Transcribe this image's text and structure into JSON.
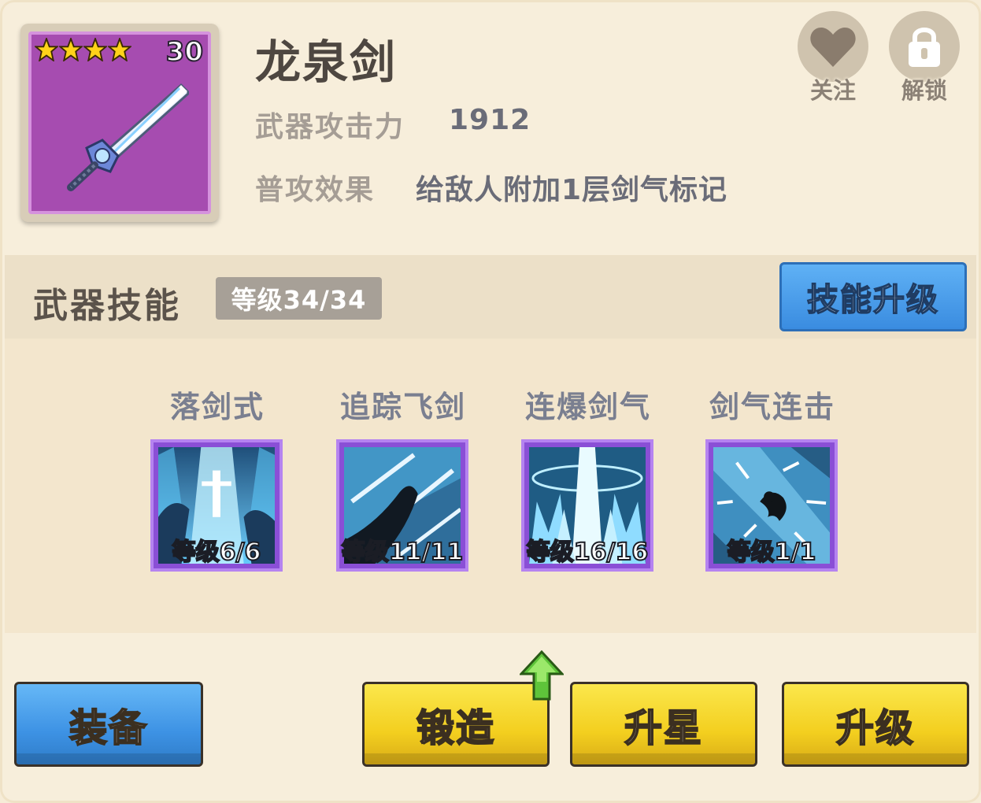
{
  "weapon": {
    "name": "龙泉剑",
    "stars": 4,
    "level": "30",
    "attack_label": "武器攻击力",
    "attack_value": "1912",
    "effect_label": "普攻效果",
    "effect_value": "给敌人附加1层剑气标记"
  },
  "actions": {
    "follow_label": "关注",
    "unlock_label": "解锁"
  },
  "skills_section": {
    "title": "武器技能",
    "level": "等级34/34",
    "upgrade_label": "技能升级"
  },
  "skills": [
    {
      "name": "落剑式",
      "level": "等级6/6"
    },
    {
      "name": "追踪飞剑",
      "level": "等级11/11"
    },
    {
      "name": "连爆剑气",
      "level": "等级16/16"
    },
    {
      "name": "剑气连击",
      "level": "等级1/1"
    }
  ],
  "bottom_buttons": {
    "equip": "装备",
    "forge": "锻造",
    "star_up": "升星",
    "level_up": "升级"
  },
  "colors": {
    "panel_bg": "#f7eedb",
    "weapon_frame_purple": "#a64cb0",
    "skill_frame_purple": "#8a4fd6",
    "button_blue": "#3d92e4",
    "button_yellow": "#f3cf1f",
    "arrow_green": "#5ec43a"
  }
}
